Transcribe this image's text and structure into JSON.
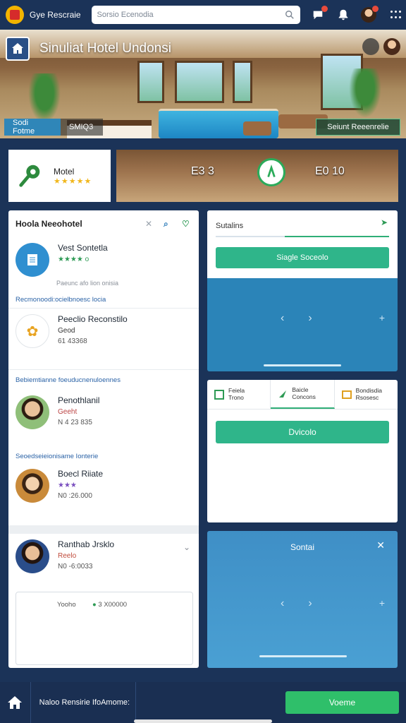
{
  "app": {
    "title": "Gye Rescraie",
    "search_placeholder": "Sorsio Ecenodia"
  },
  "hero": {
    "title": "Sinuliat Hotel Undonsi",
    "tab_left": "Sodi Fotme",
    "tab_mid": "SMIQ3",
    "tab_right": "Seiunt Reeenrelie"
  },
  "hotel_card": {
    "title": "Motel",
    "rating": 5
  },
  "lobby": {
    "left_text": "E3 3",
    "right_text": "E0 10"
  },
  "list": {
    "title": "Hoola Neeohotel",
    "items": [
      {
        "name": "Vest Sontetla",
        "sub": "★★★★ o",
        "num": ""
      },
      {
        "name": "Peeclio Reconstilo",
        "sub": "Geod",
        "num": "61 43368"
      },
      {
        "name": "Penothlanil",
        "sub": "Geeht",
        "num": "N 4 23 835"
      },
      {
        "name": "Boecl Riiate",
        "sub": "★★★",
        "num": "N0 :26.000"
      },
      {
        "name": "Ranthab Jrsklo",
        "sub": "Reelo",
        "num": "N0 -6:0033"
      }
    ],
    "muted_1": "Paeunc afo lion onisia",
    "link_1": "Recmonoodi:ocielbnoesc locia",
    "link_2": "Bebiemtianne foeuducnenuloennes",
    "link_3": "Seoedseieionisame Ionterie",
    "bottom_left": "Yooho",
    "bottom_right": "3 X00000"
  },
  "panel1": {
    "label": "Sutalins",
    "button": "Siagle Soceolo"
  },
  "panel2": {
    "tabs": [
      {
        "line1": "Feiela",
        "line2": "Trono"
      },
      {
        "line1": "Baicle",
        "line2": "Concons"
      },
      {
        "line1": "Bondisdia",
        "line2": "Rsosesc"
      }
    ],
    "button": "Dvicolo"
  },
  "panel3": {
    "title": "Sontai"
  },
  "footer": {
    "text": "Naloo Rensirie IfoAmome:",
    "button": "Voeme"
  },
  "colors": {
    "nav": "#1b3358",
    "accent_green": "#2fb58a",
    "panel_blue": "#2b84b8"
  }
}
